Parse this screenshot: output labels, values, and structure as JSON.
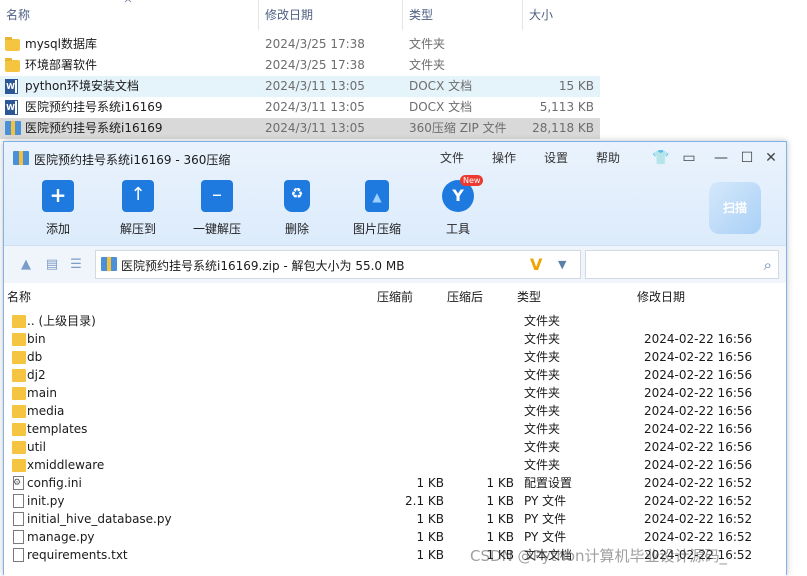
{
  "explorer": {
    "columns": {
      "name": "名称",
      "date": "修改日期",
      "type": "类型",
      "size": "大小"
    },
    "rows": [
      {
        "name": "mysql数据库",
        "date": "2024/3/25 17:38",
        "type": "文件夹",
        "size": "",
        "icon": "folder-icon"
      },
      {
        "name": "环境部署软件",
        "date": "2024/3/25 17:38",
        "type": "文件夹",
        "size": "",
        "icon": "folder-icon"
      },
      {
        "name": "python环境安装文档",
        "date": "2024/3/11 13:05",
        "type": "DOCX 文档",
        "size": "15 KB",
        "icon": "docx-icon"
      },
      {
        "name": "医院预约挂号系统i16169",
        "date": "2024/3/11 13:05",
        "type": "DOCX 文档",
        "size": "5,113 KB",
        "icon": "docx-icon"
      },
      {
        "name": "医院预约挂号系统i16169",
        "date": "2024/3/11 13:05",
        "type": "360压缩 ZIP 文件",
        "size": "28,118 KB",
        "icon": "zip-icon"
      }
    ]
  },
  "zipwin": {
    "title": "医院预约挂号系统i16169 - 360压缩",
    "menu": [
      "文件",
      "操作",
      "设置",
      "帮助"
    ],
    "toolbar": [
      "添加",
      "解压到",
      "一键解压",
      "删除",
      "图片压缩",
      "工具"
    ],
    "new_badge": "New",
    "scan_label": "扫描",
    "address": "医院预约挂号系统i16169.zip - 解包大小为 55.0 MB",
    "search": {
      "placeholder": ""
    },
    "columns": {
      "name": "名称",
      "before": "压缩前",
      "after": "压缩后",
      "type": "类型",
      "date": "修改日期"
    },
    "rows": [
      {
        "name": ".. (上级目录)",
        "before": "",
        "after": "",
        "type": "文件夹",
        "date": "",
        "kind": "folder"
      },
      {
        "name": "bin",
        "before": "",
        "after": "",
        "type": "文件夹",
        "date": "2024-02-22 16:56",
        "kind": "folder"
      },
      {
        "name": "db",
        "before": "",
        "after": "",
        "type": "文件夹",
        "date": "2024-02-22 16:56",
        "kind": "folder"
      },
      {
        "name": "dj2",
        "before": "",
        "after": "",
        "type": "文件夹",
        "date": "2024-02-22 16:56",
        "kind": "folder"
      },
      {
        "name": "main",
        "before": "",
        "after": "",
        "type": "文件夹",
        "date": "2024-02-22 16:56",
        "kind": "folder"
      },
      {
        "name": "media",
        "before": "",
        "after": "",
        "type": "文件夹",
        "date": "2024-02-22 16:56",
        "kind": "folder"
      },
      {
        "name": "templates",
        "before": "",
        "after": "",
        "type": "文件夹",
        "date": "2024-02-22 16:56",
        "kind": "folder"
      },
      {
        "name": "util",
        "before": "",
        "after": "",
        "type": "文件夹",
        "date": "2024-02-22 16:56",
        "kind": "folder"
      },
      {
        "name": "xmiddleware",
        "before": "",
        "after": "",
        "type": "文件夹",
        "date": "2024-02-22 16:56",
        "kind": "folder"
      },
      {
        "name": "config.ini",
        "before": "1 KB",
        "after": "1 KB",
        "type": "配置设置",
        "date": "2024-02-22 16:52",
        "kind": "cfg"
      },
      {
        "name": "init.py",
        "before": "2.1 KB",
        "after": "1 KB",
        "type": "PY 文件",
        "date": "2024-02-22 16:52",
        "kind": "file"
      },
      {
        "name": "initial_hive_database.py",
        "before": "1 KB",
        "after": "1 KB",
        "type": "PY 文件",
        "date": "2024-02-22 16:52",
        "kind": "file"
      },
      {
        "name": "manage.py",
        "before": "1 KB",
        "after": "1 KB",
        "type": "PY 文件",
        "date": "2024-02-22 16:52",
        "kind": "file"
      },
      {
        "name": "requirements.txt",
        "before": "1 KB",
        "after": "1 KB",
        "type": "文本文档",
        "date": "2024-02-22 16:52",
        "kind": "file"
      }
    ]
  },
  "watermark": "CSDN @Python计算机毕业设计源码_"
}
